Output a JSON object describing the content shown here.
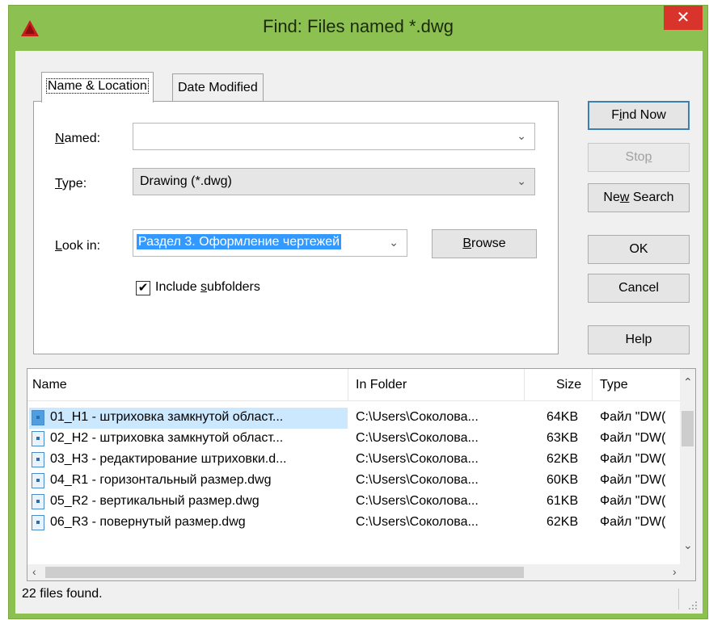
{
  "window": {
    "title": "Find: Files named *.dwg",
    "close_glyph": "✕"
  },
  "tabs": [
    {
      "label": "Name & Location"
    },
    {
      "label": "Date Modified"
    }
  ],
  "form": {
    "named_label_pre": "",
    "named_label_u": "N",
    "named_label_post": "amed:",
    "named_value": "",
    "type_label_u": "T",
    "type_label_post": "ype:",
    "type_value": "Drawing (*.dwg)",
    "lookin_label_u": "L",
    "lookin_label_post": "ook in:",
    "lookin_value": "Раздел 3. Оформление чертежей",
    "browse_u": "B",
    "browse_post": "rowse",
    "include_pre": "Include ",
    "include_u": "s",
    "include_post": "ubfolders",
    "include_checked": true
  },
  "buttons": {
    "find_now_pre": "F",
    "find_now_u": "i",
    "find_now_post": "nd Now",
    "stop_pre": "Sto",
    "stop_u": "p",
    "new_search_pre": "Ne",
    "new_search_u": "w",
    "new_search_post": " Search",
    "ok": "OK",
    "cancel": "Cancel",
    "help": "Help"
  },
  "results": {
    "columns": [
      "Name",
      "In Folder",
      "Size",
      "Type"
    ],
    "rows": [
      {
        "name": "01_H1 - штриховка замкнутой област...",
        "folder": "C:\\Users\\Соколова...",
        "size": "64KB",
        "type": "Файл \"DW("
      },
      {
        "name": "02_H2 - штриховка замкнутой област...",
        "folder": "C:\\Users\\Соколова...",
        "size": "63KB",
        "type": "Файл \"DW("
      },
      {
        "name": "03_H3 - редактирование штриховки.d...",
        "folder": "C:\\Users\\Соколова...",
        "size": "62KB",
        "type": "Файл \"DW("
      },
      {
        "name": "04_R1 - горизонтальный размер.dwg",
        "folder": "C:\\Users\\Соколова...",
        "size": "60KB",
        "type": "Файл \"DW("
      },
      {
        "name": "05_R2 - вертикальный размер.dwg",
        "folder": "C:\\Users\\Соколова...",
        "size": "61KB",
        "type": "Файл \"DW("
      },
      {
        "name": "06_R3 - повернутый размер.dwg",
        "folder": "C:\\Users\\Соколова...",
        "size": "62KB",
        "type": "Файл \"DW("
      }
    ]
  },
  "status": {
    "text": "22 files found."
  },
  "colors": {
    "titlebar": "#8cc152",
    "close": "#d9342b",
    "selection": "#3399ff"
  }
}
